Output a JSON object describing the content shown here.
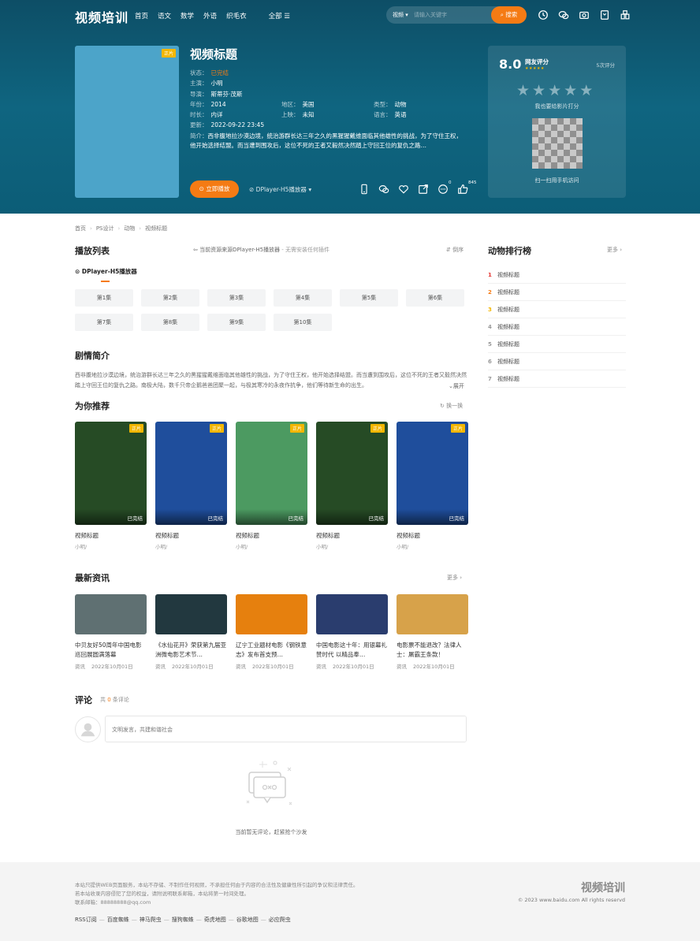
{
  "site": {
    "logo": "视频培训"
  },
  "nav": {
    "items": [
      "首页",
      "语文",
      "数学",
      "外语",
      "织毛衣"
    ],
    "all": "全部 ☰"
  },
  "search": {
    "category": "视频",
    "placeholder": "请输入关键字",
    "button": "搜索"
  },
  "video": {
    "tag": "正片",
    "title": "视频标题",
    "status_label": "状态：",
    "status": "已完结",
    "cast_label": "主演：",
    "cast": "小明",
    "director_label": "导演：",
    "director": "斯蒂芬·茂斯",
    "year_label": "年份：",
    "year": "2014",
    "region_label": "地区：",
    "region": "美国",
    "type_label": "类型：",
    "type": "动物",
    "duration_label": "时长：",
    "duration": "内详",
    "release_label": "上映：",
    "release": "未知",
    "language_label": "语言：",
    "language": "英语",
    "updated_label": "更新：",
    "updated": "2022-09-22 23:45",
    "synopsis_label": "简介：",
    "synopsis": "西非腹地拉沙漠边境，统治游群长达三年之久的黑猩猩戴维面临其他雄性的挑战，为了守住王权，他开始选择结盟。而当遭到围攻后，这位不死的王者又毅然决然踏上守回王位的复仇之路…",
    "play_button": "立即播放",
    "player_select": "DPlayer-H5播放器",
    "comment_count": "0",
    "like_count": "845"
  },
  "rating": {
    "score": "8.0",
    "label": "网友评分",
    "count": "5次评分",
    "hint": "我也要给影片打分",
    "qr_text": "扫一扫用手机访问"
  },
  "breadcrumb": [
    "首页",
    "PS设计",
    "动物",
    "视频标题"
  ],
  "playlist": {
    "title": "播放列表",
    "source_note": "当前资源来源DPlayer-H5播放器",
    "source_note_tail": " - 无需安装任何插件",
    "order": "倒序",
    "player_tab": "DPlayer-H5播放器",
    "episodes": [
      "第1集",
      "第2集",
      "第3集",
      "第4集",
      "第5集",
      "第6集",
      "第7集",
      "第8集",
      "第9集",
      "第10集"
    ]
  },
  "plot": {
    "title": "剧情简介",
    "text": "西非腹地拉沙漠边境，统治游群长达三年之久的黑猩猩戴维面临其他雄性的挑战，为了守住王权，他开始选择结盟。而当遭到围攻后，这位不死的王者又毅然决然踏上守回王位的复仇之路。南极大陆，数千只帝企鹅爸爸团聚一起，与极其寒冷的永夜作抗争，他们等待新生命的出生。",
    "expand": "展开"
  },
  "recommend": {
    "title": "为你推荐",
    "refresh": "换一换",
    "items": [
      {
        "tag": "正片",
        "status": "已完结",
        "name": "视频标题",
        "actor": "小明/",
        "color": "#264b25"
      },
      {
        "tag": "正片",
        "status": "已完结",
        "name": "视频标题",
        "actor": "小明/",
        "color": "#1f4e9c"
      },
      {
        "tag": "正片",
        "status": "已完结",
        "name": "视频标题",
        "actor": "小明/",
        "color": "#4c9a61"
      },
      {
        "tag": "正片",
        "status": "已完结",
        "name": "视频标题",
        "actor": "小明/",
        "color": "#264b25"
      },
      {
        "tag": "正片",
        "status": "已完结",
        "name": "视频标题",
        "actor": "小明/",
        "color": "#1f4e9c"
      }
    ]
  },
  "news": {
    "title": "最新资讯",
    "more": "更多",
    "items": [
      {
        "title": "中贝友好50周年中国电影巡回展圆满落幕",
        "cat": "资讯",
        "date": "2022年10月01日",
        "color": "#5f7072"
      },
      {
        "title": "《水仙花开》荣获第九届亚洲微电影艺术节…",
        "cat": "资讯",
        "date": "2022年10月01日",
        "color": "#22383f"
      },
      {
        "title": "辽宁工业题材电影《钢铁意志》发布首支预…",
        "cat": "资讯",
        "date": "2022年10月01日",
        "color": "#e6800e"
      },
      {
        "title": "中国电影这十年：用银幕礼赞时代 以精品奉…",
        "cat": "资讯",
        "date": "2022年10月01日",
        "color": "#2a3d6e"
      },
      {
        "title": "电影票不能退改？法律人士：屠霸王条款！",
        "cat": "资讯",
        "date": "2022年10月01日",
        "color": "#d7a24a"
      }
    ]
  },
  "comments": {
    "title": "评论",
    "count_prefix": "共 ",
    "count": "0",
    "count_suffix": " 条评论",
    "placeholder": "文明发言，共建和谐社会",
    "empty": "当前暂无评论，赶紧抢个沙发"
  },
  "sidebar": {
    "title": "动物排行榜",
    "more": "更多",
    "items": [
      {
        "no": "1",
        "title": "视频标题"
      },
      {
        "no": "2",
        "title": "视频标题"
      },
      {
        "no": "3",
        "title": "视频标题"
      },
      {
        "no": "4",
        "title": "视频标题"
      },
      {
        "no": "5",
        "title": "视频标题"
      },
      {
        "no": "6",
        "title": "视频标题"
      },
      {
        "no": "7",
        "title": "视频标题"
      }
    ]
  },
  "footer": {
    "line1": "本站只提供WEB页面服务，本站不存储、不制作任何视频，不承担任何由于内容的合法性及健康性所引起的争议和法律责任。",
    "line2": "若本站收录内容侵犯了您的权益，请附说明联系邮箱，本站将第一时间处理。",
    "line3": "联系邮箱：88888888@qq.com",
    "links": [
      "RSS订阅",
      "百度蜘蛛",
      "神马爬虫",
      "搜狗蜘蛛",
      "奇虎地图",
      "谷歌地图",
      "必应爬虫"
    ],
    "brand": "视频培训",
    "copyright": "© 2023 www.baidu.com All rights reservd"
  },
  "colors": {
    "accent": "#f57b14",
    "hero": "#0f6580",
    "tag": "#f3b600"
  }
}
